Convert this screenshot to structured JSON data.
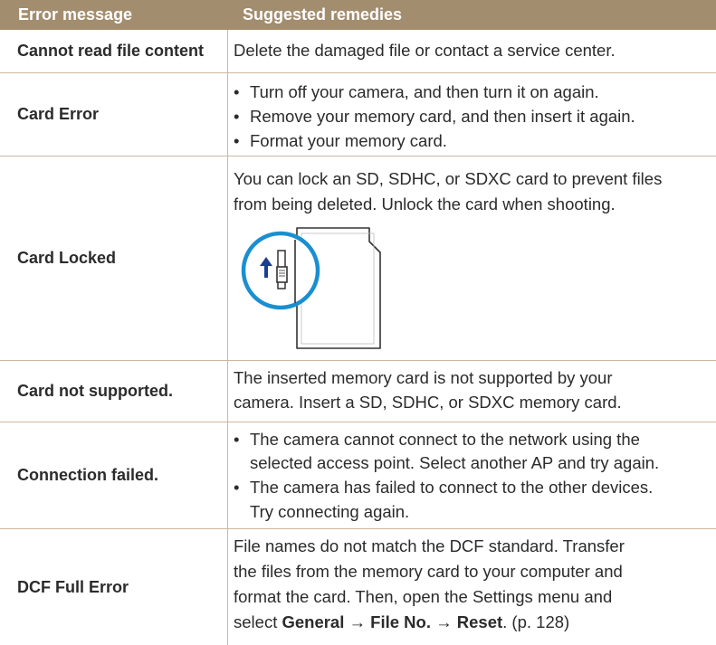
{
  "header": {
    "col_error": "Error message",
    "col_remedy": "Suggested remedies"
  },
  "rows": [
    {
      "error": "Cannot read file content",
      "text": "Delete the damaged file or contact a service center."
    },
    {
      "error": "Card Error",
      "bullets": [
        "Turn off your camera, and then turn it on again.",
        "Remove your memory card, and then insert it again.",
        "Format your memory card."
      ]
    },
    {
      "error": "Card Locked",
      "line1": "You can lock an SD, SDHC, or SDXC card to prevent files",
      "line2": "from being deleted. Unlock the card when shooting."
    },
    {
      "error": "Card not supported.",
      "line1": "The inserted memory card is not supported by your",
      "line2": "camera. Insert a SD, SDHC, or SDXC memory card."
    },
    {
      "error": "Connection failed.",
      "b1_line1": "The camera cannot connect to the network using the",
      "b1_line2": "selected access point. Select another AP and try again.",
      "b2_line1": "The camera has failed to connect to the other devices.",
      "b2_line2": "Try connecting again."
    },
    {
      "error": "DCF Full Error",
      "line1": "File names do not match the DCF standard. Transfer",
      "line2": "the files from the memory card to your computer and",
      "line3": "format the card. Then, open the Settings menu and",
      "line4_pre": "select ",
      "menu_general": "General",
      "arrow": "→",
      "menu_fileno": "File No.",
      "menu_reset": "Reset",
      "line4_post": ". (p. 128)"
    }
  ],
  "bullet_char": "•",
  "colors": {
    "header_bg": "#a38d6f",
    "rule": "#cbb89e",
    "lock_circle": "#1a8fd0"
  }
}
